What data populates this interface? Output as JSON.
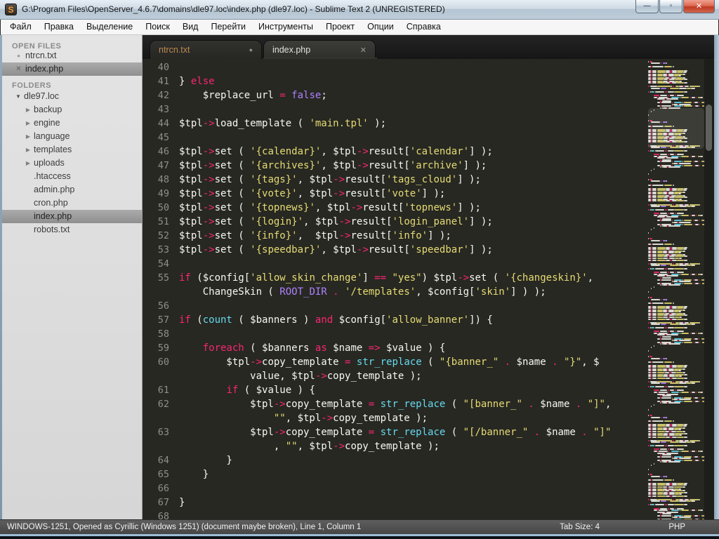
{
  "window": {
    "title": "G:\\Program Files\\OpenServer_4.6.7\\domains\\dle97.loc\\index.php (dle97.loc) - Sublime Text 2 (UNREGISTERED)",
    "icon_letter": "S",
    "controls": {
      "minimize": "—",
      "maximize": "▫",
      "close": "✕"
    }
  },
  "menu": {
    "items": [
      "Файл",
      "Правка",
      "Выделение",
      "Поиск",
      "Вид",
      "Перейти",
      "Инструменты",
      "Проект",
      "Опции",
      "Справка"
    ]
  },
  "sidebar": {
    "open_files_header": "OPEN FILES",
    "open_files": [
      {
        "label": "ntrcn.txt",
        "icon": "dot",
        "selected": false
      },
      {
        "label": "index.php",
        "icon": "close",
        "selected": true
      }
    ],
    "folders_header": "FOLDERS",
    "tree": [
      {
        "label": "dle97.loc",
        "arrow": "open",
        "depth": 0,
        "selected": false
      },
      {
        "label": "backup",
        "arrow": "closed",
        "depth": 1,
        "selected": false
      },
      {
        "label": "engine",
        "arrow": "closed",
        "depth": 1,
        "selected": false
      },
      {
        "label": "language",
        "arrow": "closed",
        "depth": 1,
        "selected": false
      },
      {
        "label": "templates",
        "arrow": "closed",
        "depth": 1,
        "selected": false
      },
      {
        "label": "uploads",
        "arrow": "closed",
        "depth": 1,
        "selected": false
      },
      {
        "label": ".htaccess",
        "arrow": "none",
        "depth": 1,
        "selected": false
      },
      {
        "label": "admin.php",
        "arrow": "none",
        "depth": 1,
        "selected": false
      },
      {
        "label": "cron.php",
        "arrow": "none",
        "depth": 1,
        "selected": false
      },
      {
        "label": "index.php",
        "arrow": "none",
        "depth": 1,
        "selected": true
      },
      {
        "label": "robots.txt",
        "arrow": "none",
        "depth": 1,
        "selected": false
      }
    ]
  },
  "tabs": [
    {
      "label": "ntrcn.txt",
      "indicator": "dot",
      "active": false
    },
    {
      "label": "index.php",
      "indicator": "close",
      "active": true
    }
  ],
  "code": {
    "lines": [
      {
        "n": "40",
        "tokens": []
      },
      {
        "n": "41",
        "tokens": [
          {
            "t": "} ",
            "c": "w"
          },
          {
            "t": "else",
            "c": "p"
          }
        ]
      },
      {
        "n": "42",
        "tokens": [
          {
            "t": "    $replace_url ",
            "c": "w"
          },
          {
            "t": "=",
            "c": "p"
          },
          {
            "t": " ",
            "c": "w"
          },
          {
            "t": "false",
            "c": "u"
          },
          {
            "t": ";",
            "c": "w"
          }
        ]
      },
      {
        "n": "43",
        "tokens": []
      },
      {
        "n": "44",
        "tokens": [
          {
            "t": "$tpl",
            "c": "w"
          },
          {
            "t": "->",
            "c": "p"
          },
          {
            "t": "load_template ( ",
            "c": "w"
          },
          {
            "t": "'main.tpl'",
            "c": "y"
          },
          {
            "t": " );",
            "c": "w"
          }
        ]
      },
      {
        "n": "45",
        "tokens": []
      },
      {
        "n": "46",
        "tokens": [
          {
            "t": "$tpl",
            "c": "w"
          },
          {
            "t": "->",
            "c": "p"
          },
          {
            "t": "set ( ",
            "c": "w"
          },
          {
            "t": "'{calendar}'",
            "c": "y"
          },
          {
            "t": ", $tpl",
            "c": "w"
          },
          {
            "t": "->",
            "c": "p"
          },
          {
            "t": "result[",
            "c": "w"
          },
          {
            "t": "'calendar'",
            "c": "y"
          },
          {
            "t": "] );",
            "c": "w"
          }
        ]
      },
      {
        "n": "47",
        "tokens": [
          {
            "t": "$tpl",
            "c": "w"
          },
          {
            "t": "->",
            "c": "p"
          },
          {
            "t": "set ( ",
            "c": "w"
          },
          {
            "t": "'{archives}'",
            "c": "y"
          },
          {
            "t": ", $tpl",
            "c": "w"
          },
          {
            "t": "->",
            "c": "p"
          },
          {
            "t": "result[",
            "c": "w"
          },
          {
            "t": "'archive'",
            "c": "y"
          },
          {
            "t": "] );",
            "c": "w"
          }
        ]
      },
      {
        "n": "48",
        "tokens": [
          {
            "t": "$tpl",
            "c": "w"
          },
          {
            "t": "->",
            "c": "p"
          },
          {
            "t": "set ( ",
            "c": "w"
          },
          {
            "t": "'{tags}'",
            "c": "y"
          },
          {
            "t": ", $tpl",
            "c": "w"
          },
          {
            "t": "->",
            "c": "p"
          },
          {
            "t": "result[",
            "c": "w"
          },
          {
            "t": "'tags_cloud'",
            "c": "y"
          },
          {
            "t": "] );",
            "c": "w"
          }
        ]
      },
      {
        "n": "49",
        "tokens": [
          {
            "t": "$tpl",
            "c": "w"
          },
          {
            "t": "->",
            "c": "p"
          },
          {
            "t": "set ( ",
            "c": "w"
          },
          {
            "t": "'{vote}'",
            "c": "y"
          },
          {
            "t": ", $tpl",
            "c": "w"
          },
          {
            "t": "->",
            "c": "p"
          },
          {
            "t": "result[",
            "c": "w"
          },
          {
            "t": "'vote'",
            "c": "y"
          },
          {
            "t": "] );",
            "c": "w"
          }
        ]
      },
      {
        "n": "50",
        "tokens": [
          {
            "t": "$tpl",
            "c": "w"
          },
          {
            "t": "->",
            "c": "p"
          },
          {
            "t": "set ( ",
            "c": "w"
          },
          {
            "t": "'{topnews}'",
            "c": "y"
          },
          {
            "t": ", $tpl",
            "c": "w"
          },
          {
            "t": "->",
            "c": "p"
          },
          {
            "t": "result[",
            "c": "w"
          },
          {
            "t": "'topnews'",
            "c": "y"
          },
          {
            "t": "] );",
            "c": "w"
          }
        ]
      },
      {
        "n": "51",
        "tokens": [
          {
            "t": "$tpl",
            "c": "w"
          },
          {
            "t": "->",
            "c": "p"
          },
          {
            "t": "set ( ",
            "c": "w"
          },
          {
            "t": "'{login}'",
            "c": "y"
          },
          {
            "t": ", $tpl",
            "c": "w"
          },
          {
            "t": "->",
            "c": "p"
          },
          {
            "t": "result[",
            "c": "w"
          },
          {
            "t": "'login_panel'",
            "c": "y"
          },
          {
            "t": "] );",
            "c": "w"
          }
        ]
      },
      {
        "n": "52",
        "tokens": [
          {
            "t": "$tpl",
            "c": "w"
          },
          {
            "t": "->",
            "c": "p"
          },
          {
            "t": "set ( ",
            "c": "w"
          },
          {
            "t": "'{info}'",
            "c": "y"
          },
          {
            "t": ",  $tpl",
            "c": "w"
          },
          {
            "t": "->",
            "c": "p"
          },
          {
            "t": "result[",
            "c": "w"
          },
          {
            "t": "'info'",
            "c": "y"
          },
          {
            "t": "] );",
            "c": "w"
          }
        ]
      },
      {
        "n": "53",
        "tokens": [
          {
            "t": "$tpl",
            "c": "w"
          },
          {
            "t": "->",
            "c": "p"
          },
          {
            "t": "set ( ",
            "c": "w"
          },
          {
            "t": "'{speedbar}'",
            "c": "y"
          },
          {
            "t": ", $tpl",
            "c": "w"
          },
          {
            "t": "->",
            "c": "p"
          },
          {
            "t": "result[",
            "c": "w"
          },
          {
            "t": "'speedbar'",
            "c": "y"
          },
          {
            "t": "] );",
            "c": "w"
          }
        ]
      },
      {
        "n": "54",
        "tokens": []
      },
      {
        "n": "55",
        "tokens": [
          {
            "t": "if",
            "c": "p"
          },
          {
            "t": " ($config[",
            "c": "w"
          },
          {
            "t": "'allow_skin_change'",
            "c": "y"
          },
          {
            "t": "] ",
            "c": "w"
          },
          {
            "t": "==",
            "c": "p"
          },
          {
            "t": " ",
            "c": "w"
          },
          {
            "t": "\"yes\"",
            "c": "y"
          },
          {
            "t": ") $tpl",
            "c": "w"
          },
          {
            "t": "->",
            "c": "p"
          },
          {
            "t": "set ( ",
            "c": "w"
          },
          {
            "t": "'{changeskin}'",
            "c": "y"
          },
          {
            "t": ",",
            "c": "w"
          }
        ]
      },
      {
        "n": "",
        "wrap": true,
        "tokens": [
          {
            "t": "    ChangeSkin ( ",
            "c": "w"
          },
          {
            "t": "ROOT_DIR",
            "c": "u"
          },
          {
            "t": " ",
            "c": "w"
          },
          {
            "t": ".",
            "c": "p"
          },
          {
            "t": " ",
            "c": "w"
          },
          {
            "t": "'/templates'",
            "c": "y"
          },
          {
            "t": ", $config[",
            "c": "w"
          },
          {
            "t": "'skin'",
            "c": "y"
          },
          {
            "t": "] ) );",
            "c": "w"
          }
        ]
      },
      {
        "n": "56",
        "tokens": []
      },
      {
        "n": "57",
        "tokens": [
          {
            "t": "if",
            "c": "p"
          },
          {
            "t": " (",
            "c": "w"
          },
          {
            "t": "count",
            "c": "b"
          },
          {
            "t": " ( $banners ) ",
            "c": "w"
          },
          {
            "t": "and",
            "c": "p"
          },
          {
            "t": " $config[",
            "c": "w"
          },
          {
            "t": "'allow_banner'",
            "c": "y"
          },
          {
            "t": "]) {",
            "c": "w"
          }
        ]
      },
      {
        "n": "58",
        "tokens": []
      },
      {
        "n": "59",
        "tokens": [
          {
            "t": "    ",
            "c": "w"
          },
          {
            "t": "foreach",
            "c": "p"
          },
          {
            "t": " ( $banners ",
            "c": "w"
          },
          {
            "t": "as",
            "c": "p"
          },
          {
            "t": " $name ",
            "c": "w"
          },
          {
            "t": "=>",
            "c": "p"
          },
          {
            "t": " $value ) {",
            "c": "w"
          }
        ]
      },
      {
        "n": "60",
        "tokens": [
          {
            "t": "        $tpl",
            "c": "w"
          },
          {
            "t": "->",
            "c": "p"
          },
          {
            "t": "copy_template ",
            "c": "w"
          },
          {
            "t": "=",
            "c": "p"
          },
          {
            "t": " ",
            "c": "w"
          },
          {
            "t": "str_replace",
            "c": "b"
          },
          {
            "t": " ( ",
            "c": "w"
          },
          {
            "t": "\"{banner_\"",
            "c": "y"
          },
          {
            "t": " ",
            "c": "w"
          },
          {
            "t": ".",
            "c": "p"
          },
          {
            "t": " $name ",
            "c": "w"
          },
          {
            "t": ".",
            "c": "p"
          },
          {
            "t": " ",
            "c": "w"
          },
          {
            "t": "\"}\"",
            "c": "y"
          },
          {
            "t": ", $",
            "c": "w"
          }
        ]
      },
      {
        "n": "",
        "wrap": true,
        "tokens": [
          {
            "t": "            value, $tpl",
            "c": "w"
          },
          {
            "t": "->",
            "c": "p"
          },
          {
            "t": "copy_template );",
            "c": "w"
          }
        ]
      },
      {
        "n": "61",
        "tokens": [
          {
            "t": "        ",
            "c": "w"
          },
          {
            "t": "if",
            "c": "p"
          },
          {
            "t": " ( $value ) {",
            "c": "w"
          }
        ]
      },
      {
        "n": "62",
        "tokens": [
          {
            "t": "            $tpl",
            "c": "w"
          },
          {
            "t": "->",
            "c": "p"
          },
          {
            "t": "copy_template ",
            "c": "w"
          },
          {
            "t": "=",
            "c": "p"
          },
          {
            "t": " ",
            "c": "w"
          },
          {
            "t": "str_replace",
            "c": "b"
          },
          {
            "t": " ( ",
            "c": "w"
          },
          {
            "t": "\"[banner_\"",
            "c": "y"
          },
          {
            "t": " ",
            "c": "w"
          },
          {
            "t": ".",
            "c": "p"
          },
          {
            "t": " $name ",
            "c": "w"
          },
          {
            "t": ".",
            "c": "p"
          },
          {
            "t": " ",
            "c": "w"
          },
          {
            "t": "\"]\"",
            "c": "y"
          },
          {
            "t": ",",
            "c": "w"
          }
        ]
      },
      {
        "n": "",
        "wrap": true,
        "tokens": [
          {
            "t": "                ",
            "c": "w"
          },
          {
            "t": "\"\"",
            "c": "y"
          },
          {
            "t": ", $tpl",
            "c": "w"
          },
          {
            "t": "->",
            "c": "p"
          },
          {
            "t": "copy_template );",
            "c": "w"
          }
        ]
      },
      {
        "n": "63",
        "tokens": [
          {
            "t": "            $tpl",
            "c": "w"
          },
          {
            "t": "->",
            "c": "p"
          },
          {
            "t": "copy_template ",
            "c": "w"
          },
          {
            "t": "=",
            "c": "p"
          },
          {
            "t": " ",
            "c": "w"
          },
          {
            "t": "str_replace",
            "c": "b"
          },
          {
            "t": " ( ",
            "c": "w"
          },
          {
            "t": "\"[/banner_\"",
            "c": "y"
          },
          {
            "t": " ",
            "c": "w"
          },
          {
            "t": ".",
            "c": "p"
          },
          {
            "t": " $name ",
            "c": "w"
          },
          {
            "t": ".",
            "c": "p"
          },
          {
            "t": " ",
            "c": "w"
          },
          {
            "t": "\"]\"",
            "c": "y"
          }
        ]
      },
      {
        "n": "",
        "wrap": true,
        "tokens": [
          {
            "t": "                , ",
            "c": "w"
          },
          {
            "t": "\"\"",
            "c": "y"
          },
          {
            "t": ", $tpl",
            "c": "w"
          },
          {
            "t": "->",
            "c": "p"
          },
          {
            "t": "copy_template );",
            "c": "w"
          }
        ]
      },
      {
        "n": "64",
        "tokens": [
          {
            "t": "        }",
            "c": "w"
          }
        ]
      },
      {
        "n": "65",
        "tokens": [
          {
            "t": "    }",
            "c": "w"
          }
        ]
      },
      {
        "n": "66",
        "tokens": []
      },
      {
        "n": "67",
        "tokens": [
          {
            "t": "}",
            "c": "w"
          }
        ]
      },
      {
        "n": "68",
        "tokens": []
      }
    ]
  },
  "status_bar": {
    "left": "WINDOWS-1251, Opened as Cyrillic (Windows 1251) (document maybe broken), Line 1, Column 1",
    "tab_size": "Tab Size: 4",
    "syntax": "PHP"
  },
  "colors": {
    "editor_bg": "#272822",
    "foreground": "#f8f8f2",
    "keyword": "#f92672",
    "string": "#e6db74",
    "constant": "#ae81ff",
    "builtin_function": "#66d9ef",
    "line_number": "#8f908a",
    "inactive_tab_label": "#bc8a4e",
    "close_button": "#c03a22"
  }
}
